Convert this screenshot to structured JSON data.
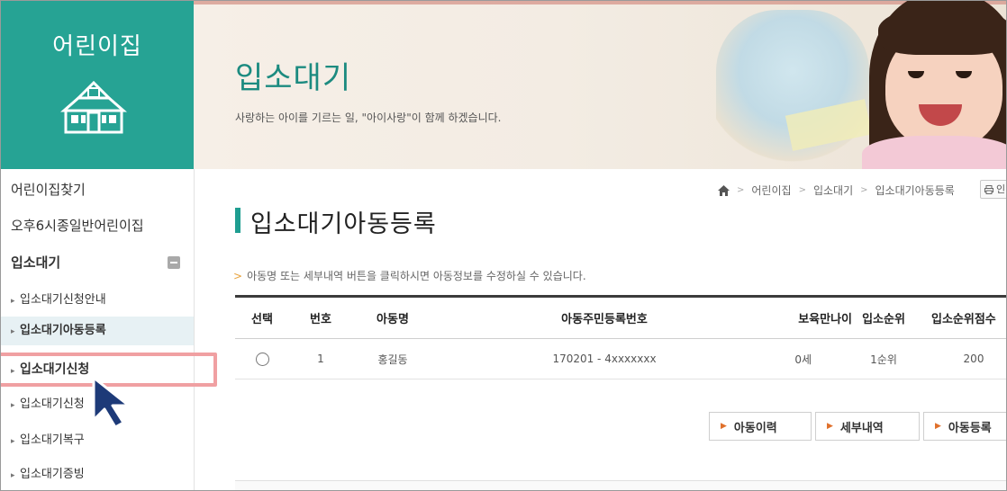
{
  "sidebar": {
    "title": "어린이집",
    "items": [
      {
        "label": "어린이집찾기"
      },
      {
        "label": "오후6시종일반어린이집"
      },
      {
        "label": "입소대기"
      },
      {
        "label": "입소대기신청안내"
      },
      {
        "label": "입소대기아동등록"
      },
      {
        "label": "입소대기신청"
      },
      {
        "label": "입소대기신청"
      },
      {
        "label": "입소대기복구"
      },
      {
        "label": "입소대기증빙"
      }
    ]
  },
  "banner": {
    "title": "입소대기",
    "subtitle": "사랑하는 아이를 기르는 일, \"아이사랑\"이 함께 하겠습니다."
  },
  "breadcrumb": {
    "items": [
      "어린이집",
      "입소대기",
      "입소대기아동등록"
    ],
    "print_label": "인"
  },
  "page": {
    "title": "입소대기아동등록",
    "notice": "아동명 또는 세부내역 버튼을 클릭하시면 아동정보를 수정하실 수 있습니다."
  },
  "table": {
    "headers": [
      "선택",
      "번호",
      "아동명",
      "아동주민등록번호",
      "보육만나이",
      "입소순위",
      "입소순위점수"
    ],
    "rows": [
      {
        "no": "1",
        "name": "홍길동",
        "rrn": "170201 - 4xxxxxxx",
        "age": "0세",
        "rank": "1순위",
        "score": "200"
      }
    ]
  },
  "buttons": {
    "history": "아동이력",
    "details": "세부내역",
    "register": "아동등록"
  },
  "colors": {
    "brand": "#26a394",
    "title_accent": "#1f9e91",
    "highlight": "#f0a0a2"
  },
  "icons": [
    "house-icon",
    "home-icon",
    "collapse-icon",
    "printer-icon",
    "mouse-cursor-icon"
  ]
}
